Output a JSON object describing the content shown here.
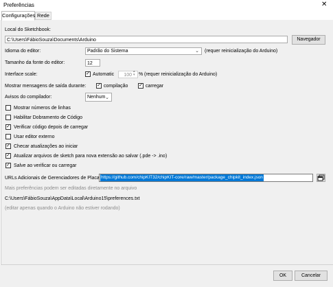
{
  "window": {
    "title": "Preferências",
    "close_glyph": "✕"
  },
  "tabs": [
    {
      "label": "Configurações",
      "active": true
    },
    {
      "label": "Rede",
      "active": false
    }
  ],
  "sketchbook": {
    "label": "Local do Sketchbook:",
    "value": "C:\\Users\\FábioSouza\\Documents\\Arduino",
    "browse_label": "Navegador"
  },
  "language": {
    "label": "Idioma do editor:",
    "value": "Padrão do Sistema",
    "note": "(requer reinicialização do Arduino)"
  },
  "font_size": {
    "label": "Tamanho da fonte do editor:",
    "value": "12"
  },
  "interface_scale": {
    "label": "Interface scale:",
    "automatic_label": "Automatic",
    "automatic_checked": true,
    "value": "100",
    "unit": "%",
    "note": "(requer reinicialização do Arduino)"
  },
  "verbose": {
    "label": "Mostrar mensagens de saída durante:",
    "compile_label": "compilação",
    "compile_checked": true,
    "upload_label": "carregar",
    "upload_checked": true
  },
  "warnings": {
    "label": "Avisos do compilador:",
    "value": "Nenhum"
  },
  "options": [
    {
      "label": "Mostrar números de linhas",
      "checked": false
    },
    {
      "label": "Habilitar Dobramento de Código",
      "checked": false
    },
    {
      "label": "Verificar código depois de carregar",
      "checked": true
    },
    {
      "label": "Usar editor externo",
      "checked": false
    },
    {
      "label": "Checar atualizações ao iniciar",
      "checked": true
    },
    {
      "label": "Atualizar arquivos de sketch para nova extensão ao salvar (.pde -> .ino)",
      "checked": true
    },
    {
      "label": "Salve ao verificar ou carregar",
      "checked": true
    }
  ],
  "boards_urls": {
    "label": "URLs Adicionais de Gerenciadores de Placas:",
    "value": "https://github.com/chipKIT32/chipKIT-core/raw/master/package_chipkit_index.json"
  },
  "more_prefs": {
    "hint": "Mais preferências podem ser editadas diretamente no arquivo",
    "path": "C:\\Users\\FábioSouza\\AppData\\Local\\Arduino15\\preferences.txt",
    "note": "(editar apenas quando o Arduino não estiver rodando)"
  },
  "buttons": {
    "ok": "OK",
    "cancel": "Cancelar"
  }
}
